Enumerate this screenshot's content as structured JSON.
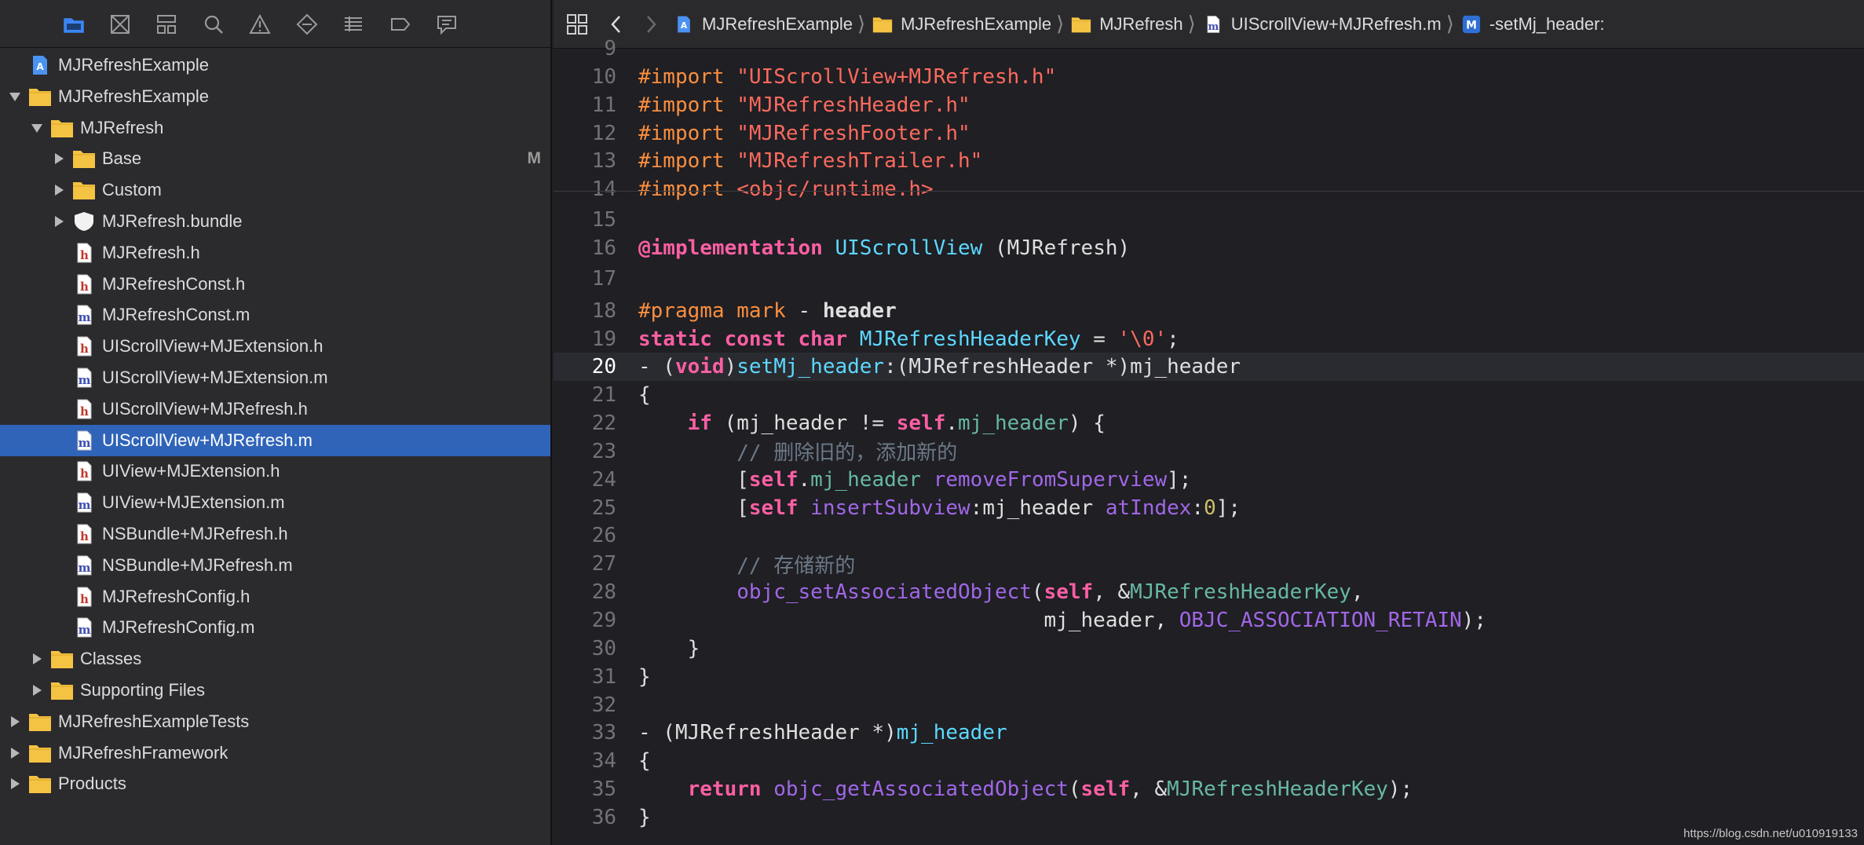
{
  "navigator": {
    "toolbar_icons": [
      "folder-icon",
      "source-control-icon",
      "symbol-icon",
      "search-icon",
      "warning-icon",
      "test-icon",
      "debug-icon",
      "breakpoint-icon",
      "report-icon"
    ],
    "tree": [
      {
        "label": "MJRefreshExample",
        "indent": 0,
        "icon": "project",
        "disclosure": "none"
      },
      {
        "label": "MJRefreshExample",
        "indent": 0,
        "icon": "folder",
        "disclosure": "open"
      },
      {
        "label": "MJRefresh",
        "indent": 1,
        "icon": "folder",
        "disclosure": "open"
      },
      {
        "label": "Base",
        "indent": 2,
        "icon": "folder",
        "disclosure": "closed",
        "badge": "M"
      },
      {
        "label": "Custom",
        "indent": 2,
        "icon": "folder",
        "disclosure": "closed"
      },
      {
        "label": "MJRefresh.bundle",
        "indent": 2,
        "icon": "bundle",
        "disclosure": "closed"
      },
      {
        "label": "MJRefresh.h",
        "indent": 2,
        "icon": "h",
        "disclosure": "none"
      },
      {
        "label": "MJRefreshConst.h",
        "indent": 2,
        "icon": "h",
        "disclosure": "none"
      },
      {
        "label": "MJRefreshConst.m",
        "indent": 2,
        "icon": "m",
        "disclosure": "none"
      },
      {
        "label": "UIScrollView+MJExtension.h",
        "indent": 2,
        "icon": "h",
        "disclosure": "none"
      },
      {
        "label": "UIScrollView+MJExtension.m",
        "indent": 2,
        "icon": "m",
        "disclosure": "none"
      },
      {
        "label": "UIScrollView+MJRefresh.h",
        "indent": 2,
        "icon": "h",
        "disclosure": "none"
      },
      {
        "label": "UIScrollView+MJRefresh.m",
        "indent": 2,
        "icon": "m",
        "disclosure": "none",
        "selected": true
      },
      {
        "label": "UIView+MJExtension.h",
        "indent": 2,
        "icon": "h",
        "disclosure": "none"
      },
      {
        "label": "UIView+MJExtension.m",
        "indent": 2,
        "icon": "m",
        "disclosure": "none"
      },
      {
        "label": "NSBundle+MJRefresh.h",
        "indent": 2,
        "icon": "h",
        "disclosure": "none"
      },
      {
        "label": "NSBundle+MJRefresh.m",
        "indent": 2,
        "icon": "m",
        "disclosure": "none"
      },
      {
        "label": "MJRefreshConfig.h",
        "indent": 2,
        "icon": "h",
        "disclosure": "none"
      },
      {
        "label": "MJRefreshConfig.m",
        "indent": 2,
        "icon": "m",
        "disclosure": "none"
      },
      {
        "label": "Classes",
        "indent": 1,
        "icon": "folder",
        "disclosure": "closed"
      },
      {
        "label": "Supporting Files",
        "indent": 1,
        "icon": "folder",
        "disclosure": "closed"
      },
      {
        "label": "MJRefreshExampleTests",
        "indent": 0,
        "icon": "folder",
        "disclosure": "closed"
      },
      {
        "label": "MJRefreshFramework",
        "indent": 0,
        "icon": "folder",
        "disclosure": "closed"
      },
      {
        "label": "Products",
        "indent": 0,
        "icon": "folder",
        "disclosure": "closed"
      }
    ]
  },
  "jumpbar": {
    "crumbs": [
      {
        "label": "MJRefreshExample",
        "icon": "project"
      },
      {
        "label": "MJRefreshExample",
        "icon": "folder"
      },
      {
        "label": "MJRefresh",
        "icon": "folder"
      },
      {
        "label": "UIScrollView+MJRefresh.m",
        "icon": "m-file"
      },
      {
        "label": "-setMj_header:",
        "icon": "method"
      }
    ]
  },
  "editor": {
    "current_line": "20",
    "lines": [
      {
        "n": "9",
        "tokens": []
      },
      {
        "n": "10",
        "tokens": [
          [
            "pp",
            "#import "
          ],
          [
            "str",
            "\"UIScrollView+MJRefresh.h\""
          ]
        ]
      },
      {
        "n": "11",
        "tokens": [
          [
            "pp",
            "#import "
          ],
          [
            "str",
            "\"MJRefreshHeader.h\""
          ]
        ]
      },
      {
        "n": "12",
        "tokens": [
          [
            "pp",
            "#import "
          ],
          [
            "str",
            "\"MJRefreshFooter.h\""
          ]
        ]
      },
      {
        "n": "13",
        "tokens": [
          [
            "pp",
            "#import "
          ],
          [
            "str",
            "\"MJRefreshTrailer.h\""
          ]
        ]
      },
      {
        "n": "14",
        "tokens": [
          [
            "pp",
            "#import "
          ],
          [
            "str",
            "<objc/runtime.h>"
          ]
        ]
      },
      {
        "n": "15",
        "tokens": []
      },
      {
        "n": "16",
        "tokens": [
          [
            "kw",
            "@implementation"
          ],
          [
            "txt",
            " "
          ],
          [
            "cls",
            "UIScrollView"
          ],
          [
            "txt",
            " (MJRefresh)"
          ]
        ]
      },
      {
        "n": "17",
        "tokens": []
      },
      {
        "n": "18",
        "tokens": [
          [
            "pp",
            "#pragma mark"
          ],
          [
            "txt",
            " - "
          ],
          [
            "bold",
            "header"
          ]
        ]
      },
      {
        "n": "19",
        "tokens": [
          [
            "kw",
            "static"
          ],
          [
            "txt",
            " "
          ],
          [
            "kw",
            "const"
          ],
          [
            "txt",
            " "
          ],
          [
            "kw",
            "char"
          ],
          [
            "txt",
            " "
          ],
          [
            "cls",
            "MJRefreshHeaderKey"
          ],
          [
            "txt",
            " = "
          ],
          [
            "str",
            "'\\0'"
          ],
          [
            "txt",
            ";"
          ]
        ]
      },
      {
        "n": "20",
        "tokens": [
          [
            "txt",
            "- ("
          ],
          [
            "kw",
            "void"
          ],
          [
            "txt",
            ")"
          ],
          [
            "cls",
            "setMj_header"
          ],
          [
            "txt",
            ":(MJRefreshHeader *)mj_header"
          ]
        ]
      },
      {
        "n": "21",
        "tokens": [
          [
            "txt",
            "{"
          ]
        ]
      },
      {
        "n": "22",
        "tokens": [
          [
            "txt",
            "    "
          ],
          [
            "kw",
            "if"
          ],
          [
            "txt",
            " (mj_header != "
          ],
          [
            "kw",
            "self"
          ],
          [
            "txt",
            "."
          ],
          [
            "prop",
            "mj_header"
          ],
          [
            "txt",
            ") {"
          ]
        ]
      },
      {
        "n": "23",
        "tokens": [
          [
            "txt",
            "        "
          ],
          [
            "cmt",
            "// 删除旧的，添加新的"
          ]
        ]
      },
      {
        "n": "24",
        "tokens": [
          [
            "txt",
            "        ["
          ],
          [
            "kw",
            "self"
          ],
          [
            "txt",
            "."
          ],
          [
            "prop",
            "mj_header"
          ],
          [
            "txt",
            " "
          ],
          [
            "fn",
            "removeFromSuperview"
          ],
          [
            "txt",
            "];"
          ]
        ]
      },
      {
        "n": "25",
        "tokens": [
          [
            "txt",
            "        ["
          ],
          [
            "kw",
            "self"
          ],
          [
            "txt",
            " "
          ],
          [
            "fn",
            "insertSubview"
          ],
          [
            "txt",
            ":mj_header "
          ],
          [
            "fn",
            "atIndex"
          ],
          [
            "txt",
            ":"
          ],
          [
            "num",
            "0"
          ],
          [
            "txt",
            "];"
          ]
        ]
      },
      {
        "n": "26",
        "tokens": []
      },
      {
        "n": "27",
        "tokens": [
          [
            "txt",
            "        "
          ],
          [
            "cmt",
            "// 存储新的"
          ]
        ]
      },
      {
        "n": "28",
        "tokens": [
          [
            "txt",
            "        "
          ],
          [
            "fn",
            "objc_setAssociatedObject"
          ],
          [
            "txt",
            "("
          ],
          [
            "kw",
            "self"
          ],
          [
            "txt",
            ", &"
          ],
          [
            "met",
            "MJRefreshHeaderKey"
          ],
          [
            "txt",
            ","
          ]
        ]
      },
      {
        "n": "29",
        "tokens": [
          [
            "txt",
            "                                 mj_header, "
          ],
          [
            "fn",
            "OBJC_ASSOCIATION_RETAIN"
          ],
          [
            "txt",
            ");"
          ]
        ]
      },
      {
        "n": "30",
        "tokens": [
          [
            "txt",
            "    }"
          ]
        ]
      },
      {
        "n": "31",
        "tokens": [
          [
            "txt",
            "}"
          ]
        ]
      },
      {
        "n": "32",
        "tokens": []
      },
      {
        "n": "33",
        "tokens": [
          [
            "txt",
            "- (MJRefreshHeader *)"
          ],
          [
            "cls",
            "mj_header"
          ]
        ]
      },
      {
        "n": "34",
        "tokens": [
          [
            "txt",
            "{"
          ]
        ]
      },
      {
        "n": "35",
        "tokens": [
          [
            "txt",
            "    "
          ],
          [
            "kw",
            "return"
          ],
          [
            "txt",
            " "
          ],
          [
            "fn",
            "objc_getAssociatedObject"
          ],
          [
            "txt",
            "("
          ],
          [
            "kw",
            "self"
          ],
          [
            "txt",
            ", &"
          ],
          [
            "met",
            "MJRefreshHeaderKey"
          ],
          [
            "txt",
            ");"
          ]
        ]
      },
      {
        "n": "36",
        "tokens": [
          [
            "txt",
            "}"
          ]
        ]
      }
    ]
  },
  "watermark": "https://blog.csdn.net/u010919133",
  "colors": {
    "selection": "#2f64b9",
    "folder": "#f5c343",
    "keyword": "#fc5fa3",
    "string": "#fc6a5d",
    "preprocessor": "#fd8f3f",
    "class": "#5dd8ff",
    "function": "#a167e6",
    "comment": "#6c7986"
  }
}
